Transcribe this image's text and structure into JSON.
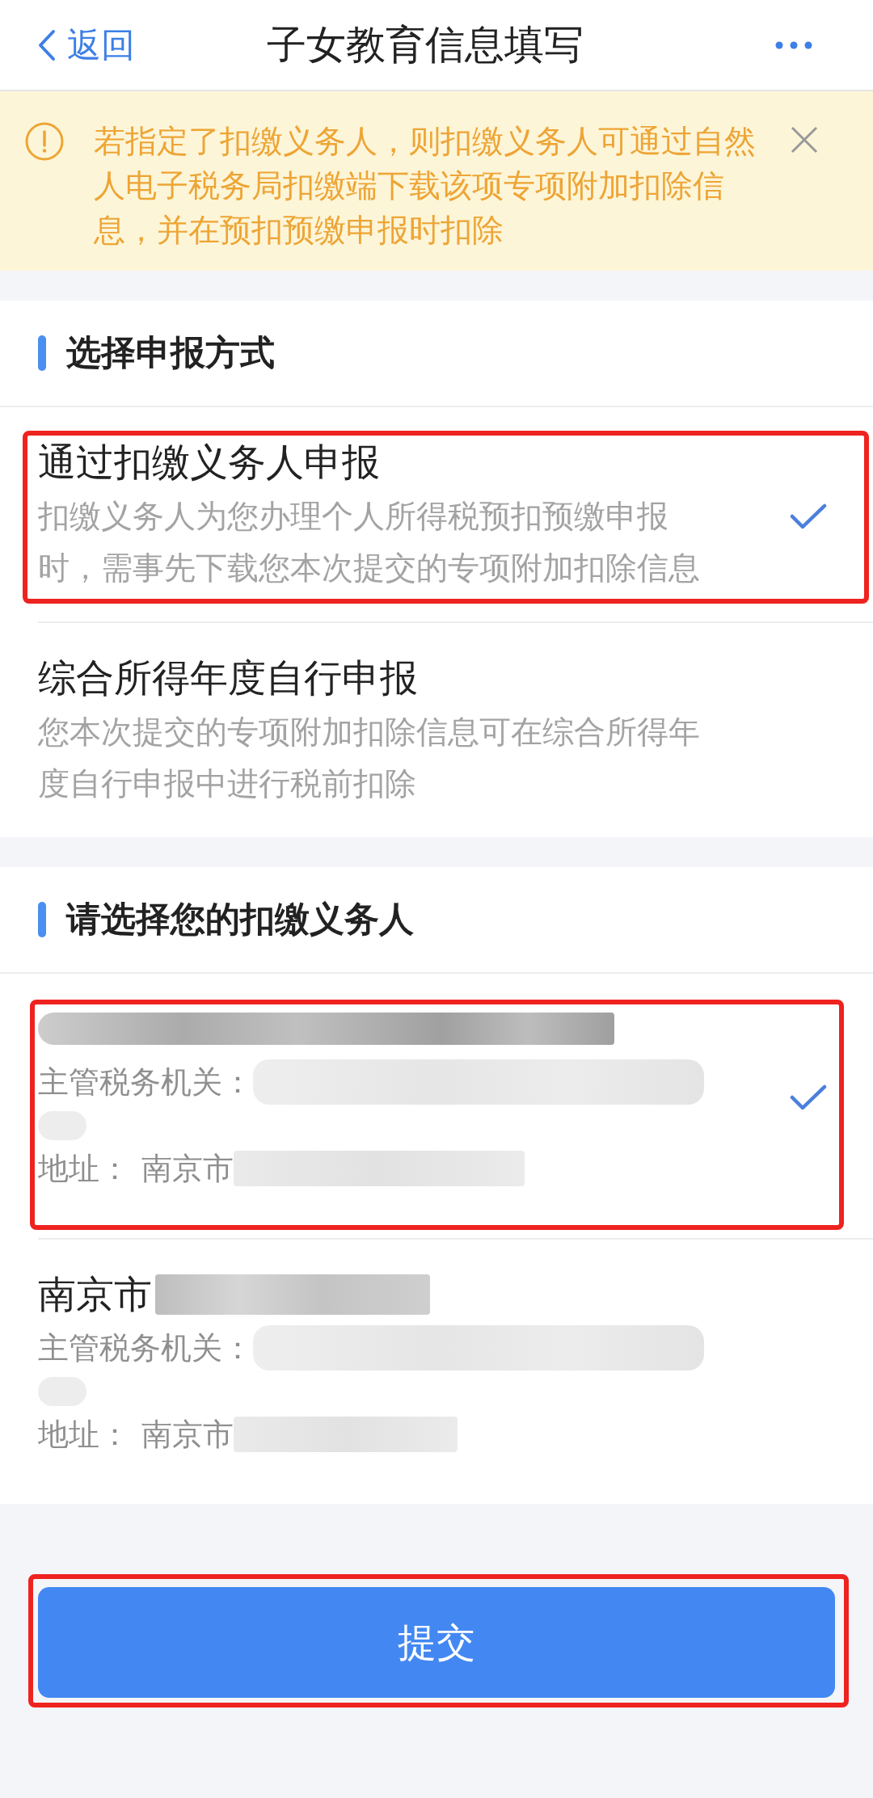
{
  "nav_bar": {
    "back_label": "返回",
    "title": "子女教育信息填写"
  },
  "notice": {
    "text": "若指定了扣缴义务人，则扣缴义务人可通过自然人电子税务局扣缴端下载该项专项附加扣除信息，并在预扣预缴申报时扣除"
  },
  "filing_method": {
    "heading": "选择申报方式",
    "options": [
      {
        "title": "通过扣缴义务人申报",
        "description": "扣缴义务人为您办理个人所得税预扣预缴申报时，需事先下载您本次提交的专项附加扣除信息",
        "selected": true,
        "highlighted": true
      },
      {
        "title": "综合所得年度自行申报",
        "description": "您本次提交的专项附加扣除信息可在综合所得年度自行申报中进行税前扣除",
        "selected": false,
        "highlighted": false
      }
    ]
  },
  "withholding_agents": {
    "heading": "请选择您的扣缴义务人",
    "agents": [
      {
        "tax_authority_label": "主管税务机关：",
        "address_label": "地址：",
        "address": "南京市",
        "selected": true,
        "highlighted": true
      },
      {
        "name": "南京市",
        "tax_authority_label": "主管税务机关：",
        "address_label": "地址：",
        "address": "南京市",
        "selected": false,
        "highlighted": false
      }
    ]
  },
  "submit_button": {
    "label": "提交",
    "highlighted": true
  }
}
